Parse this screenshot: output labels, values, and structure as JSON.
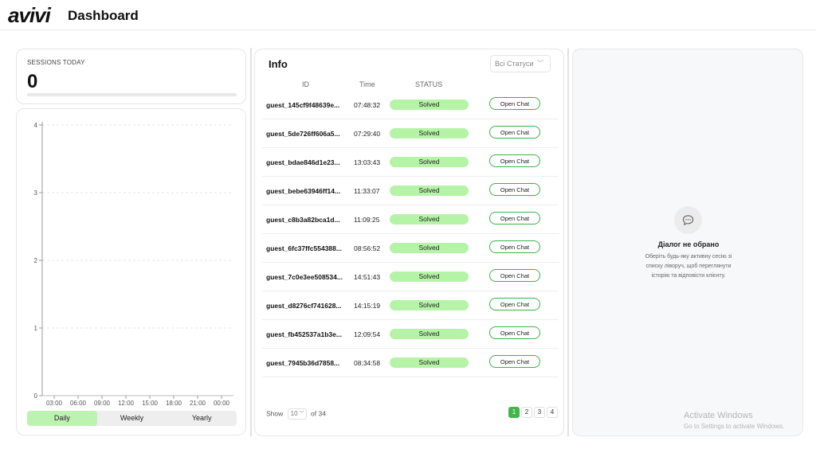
{
  "header": {
    "logo": "avivi",
    "title": "Dashboard"
  },
  "sessions": {
    "label": "SESSIONS TODAY",
    "value": "0",
    "progress": 0
  },
  "chart_data": {
    "type": "line",
    "x": [
      "03:00",
      "06:00",
      "09:00",
      "12:00",
      "15:00",
      "18:00",
      "21:00",
      "00:00"
    ],
    "yticks": [
      "0",
      "1",
      "2",
      "3",
      "4"
    ],
    "ylim": [
      0,
      4
    ],
    "series": [],
    "grid": true
  },
  "period": {
    "options": [
      "Daily",
      "Weekly",
      "Yearly"
    ],
    "active": 0
  },
  "info": {
    "title": "Info",
    "filter": "Всі Статуси",
    "columns": [
      "ID",
      "Time",
      "STATUS"
    ],
    "button_label": "Open Chat",
    "rows": [
      {
        "id": "guest_145cf9f48639e...",
        "time": "07:48:32",
        "status": "Solved"
      },
      {
        "id": "guest_5de726ff606a5...",
        "time": "07:29:40",
        "status": "Solved"
      },
      {
        "id": "guest_bdae846d1e23...",
        "time": "13:03:43",
        "status": "Solved"
      },
      {
        "id": "guest_bebe63946ff14...",
        "time": "11:33:07",
        "status": "Solved"
      },
      {
        "id": "guest_c8b3a82bca1d...",
        "time": "11:09:25",
        "status": "Solved"
      },
      {
        "id": "guest_6fc37ffc554388...",
        "time": "08:56:52",
        "status": "Solved"
      },
      {
        "id": "guest_7c0e3ee508534...",
        "time": "14:51:43",
        "status": "Solved"
      },
      {
        "id": "guest_d8276cf741628...",
        "time": "14:15:19",
        "status": "Solved"
      },
      {
        "id": "guest_fb452537a1b3e...",
        "time": "12:09:54",
        "status": "Solved"
      },
      {
        "id": "guest_7945b36d7858...",
        "time": "08:34:58",
        "status": "Solved"
      }
    ],
    "footer": {
      "show_label": "Show",
      "page_size": "10",
      "of_label": "of 34"
    },
    "pages": [
      "1",
      "2",
      "3",
      "4"
    ],
    "active_page": 0
  },
  "chat": {
    "empty_title": "Діалог не обрано",
    "empty_text": "Оберіть будь-яку активну сесію зі списку ліворуч, щоб переглянути історію та відповісти клієнту.",
    "watermark_title": "Activate Windows",
    "watermark_text": "Go to Settings to activate Windows."
  },
  "colors": {
    "accent": "#43b649",
    "solved": "#b5f3a7",
    "active_tab": "#bdf3b0"
  }
}
